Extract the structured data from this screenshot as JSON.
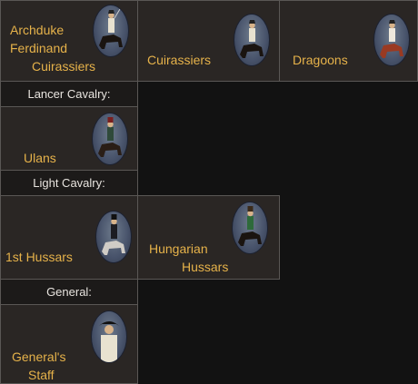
{
  "units": {
    "archduke": {
      "lines": [
        "Archduke",
        "Ferdinand",
        "Cuirassiers"
      ],
      "portrait": "cuirassier-rider-icon"
    },
    "cuirassiers": {
      "lines": [
        "Cuirassiers"
      ],
      "portrait": "cuirassier-rider-icon"
    },
    "dragoons": {
      "lines": [
        "Dragoons"
      ],
      "portrait": "dragoon-rider-icon"
    },
    "ulans": {
      "lines": [
        "Ulans"
      ],
      "portrait": "lancer-rider-icon"
    },
    "hussars1": {
      "lines": [
        "1st Hussars"
      ],
      "portrait": "hussar-rider-icon"
    },
    "hungarian": {
      "lines": [
        "Hungarian",
        "Hussars"
      ],
      "portrait": "hussar-rider-icon"
    },
    "general": {
      "lines": [
        "General's",
        "Staff"
      ],
      "portrait": "general-portrait-icon"
    }
  },
  "headers": {
    "lancer": "Lancer Cavalry:",
    "light": "Light Cavalry:",
    "general": "General:"
  },
  "colors": {
    "label": "#e6b24a",
    "cell_bg": "#2a2624",
    "header_bg": "#1c1a19",
    "border": "#5a5755",
    "background": "#121212"
  }
}
